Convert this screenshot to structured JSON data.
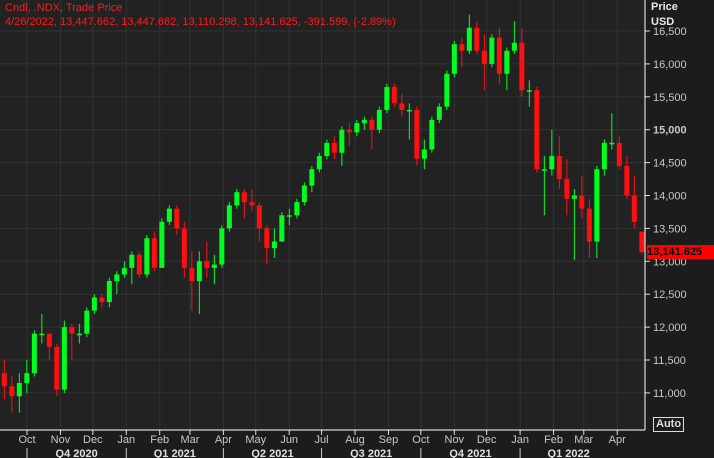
{
  "header": {
    "line1": "Cndl, .NDX, Trade Price",
    "line2": "4/26/2022, 13,447.662, 13,447.662, 13,110.298, 13,141.625, -391.599, (-2.89%)"
  },
  "axis": {
    "title1": "Price",
    "title2": "USD",
    "auto_label": "Auto"
  },
  "last_price_label": "13,141.625",
  "colors": {
    "up": "#00ff1e",
    "down": "#ff1010",
    "background": "#1c1c1c",
    "grid": "#333333"
  },
  "chart_data": {
    "type": "candlestick",
    "title": "Cndl, .NDX, Trade Price",
    "ylabel": "Price USD",
    "ylim": [
      10600,
      17000
    ],
    "y_ticks": [
      11000,
      11500,
      12000,
      12500,
      13000,
      13500,
      14000,
      14500,
      15000,
      15500,
      16000,
      16500
    ],
    "y_tick_labels": [
      "11,000",
      "11,500",
      "12,000",
      "12,500",
      "13,000",
      "13,500",
      "14,000",
      "14,500",
      "15,000",
      "15,500",
      "16,000",
      "16,500"
    ],
    "month_labels": [
      {
        "label": "Oct",
        "date": "2020-10-01"
      },
      {
        "label": "Nov",
        "date": "2020-11-01"
      },
      {
        "label": "Dec",
        "date": "2020-12-01"
      },
      {
        "label": "Jan",
        "date": "2021-01-01"
      },
      {
        "label": "Feb",
        "date": "2021-02-01"
      },
      {
        "label": "Mar",
        "date": "2021-03-01"
      },
      {
        "label": "Apr",
        "date": "2021-04-01"
      },
      {
        "label": "May",
        "date": "2021-05-01"
      },
      {
        "label": "Jun",
        "date": "2021-06-01"
      },
      {
        "label": "Jul",
        "date": "2021-07-01"
      },
      {
        "label": "Aug",
        "date": "2021-08-01"
      },
      {
        "label": "Sep",
        "date": "2021-09-01"
      },
      {
        "label": "Oct",
        "date": "2021-10-01"
      },
      {
        "label": "Nov",
        "date": "2021-11-01"
      },
      {
        "label": "Dec",
        "date": "2021-12-01"
      },
      {
        "label": "Jan",
        "date": "2022-01-01"
      },
      {
        "label": "Feb",
        "date": "2022-02-01"
      },
      {
        "label": "Mar",
        "date": "2022-03-01"
      },
      {
        "label": "Apr",
        "date": "2022-04-01"
      }
    ],
    "quarter_labels": [
      {
        "label": "Q4 2020",
        "start": "2020-10-01",
        "end": "2021-01-01"
      },
      {
        "label": "Q1 2021",
        "start": "2021-01-01",
        "end": "2021-04-01"
      },
      {
        "label": "Q2 2021",
        "start": "2021-04-01",
        "end": "2021-07-01"
      },
      {
        "label": "Q3 2021",
        "start": "2021-07-01",
        "end": "2021-10-01"
      },
      {
        "label": "Q4 2021",
        "start": "2021-10-01",
        "end": "2022-01-01"
      },
      {
        "label": "Q1 2022",
        "start": "2022-01-01",
        "end": "2022-04-01"
      }
    ],
    "candle_period": "weekly (approximation)",
    "first_candle_date": "2020-09-10",
    "candles_ohlc": [
      [
        11300,
        11500,
        10900,
        11100
      ],
      [
        11100,
        11250,
        10700,
        10950
      ],
      [
        10950,
        11300,
        10700,
        11150
      ],
      [
        11150,
        11500,
        11000,
        11300
      ],
      [
        11300,
        11950,
        11250,
        11900
      ],
      [
        11900,
        12200,
        11750,
        11900
      ],
      [
        11900,
        11900,
        11500,
        11700
      ],
      [
        11700,
        11750,
        10950,
        11050
      ],
      [
        11050,
        12100,
        11000,
        12000
      ],
      [
        12000,
        12050,
        11500,
        11900
      ],
      [
        11900,
        12050,
        11750,
        11900
      ],
      [
        11900,
        12300,
        11850,
        12250
      ],
      [
        12250,
        12500,
        12200,
        12450
      ],
      [
        12450,
        12500,
        12300,
        12380
      ],
      [
        12380,
        12750,
        12300,
        12700
      ],
      [
        12700,
        12850,
        12500,
        12800
      ],
      [
        12800,
        13000,
        12750,
        12900
      ],
      [
        12900,
        13150,
        12650,
        13100
      ],
      [
        13100,
        13150,
        12750,
        12800
      ],
      [
        12800,
        13400,
        12750,
        13350
      ],
      [
        13350,
        13450,
        12850,
        12900
      ],
      [
        12900,
        13650,
        12900,
        13600
      ],
      [
        13600,
        13850,
        13550,
        13800
      ],
      [
        13800,
        13850,
        13400,
        13500
      ],
      [
        13500,
        13600,
        12750,
        12900
      ],
      [
        12900,
        13150,
        12250,
        12700
      ],
      [
        12700,
        13150,
        12200,
        13000
      ],
      [
        13000,
        13300,
        12750,
        12900
      ],
      [
        12900,
        13100,
        12650,
        12950
      ],
      [
        12950,
        13550,
        12900,
        13500
      ],
      [
        13500,
        13900,
        13450,
        13850
      ],
      [
        13850,
        14100,
        13800,
        14050
      ],
      [
        14050,
        14100,
        13650,
        13900
      ],
      [
        13900,
        14100,
        13750,
        13850
      ],
      [
        13850,
        13900,
        13300,
        13500
      ],
      [
        13500,
        13550,
        12950,
        13200
      ],
      [
        13200,
        13500,
        13050,
        13300
      ],
      [
        13300,
        13750,
        13300,
        13700
      ],
      [
        13700,
        13800,
        13550,
        13700
      ],
      [
        13700,
        13950,
        13650,
        13900
      ],
      [
        13900,
        14200,
        13850,
        14150
      ],
      [
        14150,
        14450,
        14050,
        14400
      ],
      [
        14400,
        14650,
        14350,
        14600
      ],
      [
        14600,
        14850,
        14550,
        14800
      ],
      [
        14800,
        14900,
        14550,
        14650
      ],
      [
        14650,
        15050,
        14450,
        15000
      ],
      [
        15000,
        15100,
        14750,
        14960
      ],
      [
        14960,
        15150,
        14900,
        15100
      ],
      [
        15100,
        15200,
        15000,
        15150
      ],
      [
        15150,
        15200,
        14700,
        15000
      ],
      [
        15000,
        15350,
        14950,
        15300
      ],
      [
        15300,
        15700,
        15250,
        15650
      ],
      [
        15650,
        15700,
        15350,
        15400
      ],
      [
        15400,
        15550,
        15200,
        15300
      ],
      [
        15300,
        15400,
        14850,
        15300
      ],
      [
        15300,
        15350,
        14450,
        14560
      ],
      [
        14560,
        14850,
        14400,
        14700
      ],
      [
        14700,
        15200,
        14650,
        15150
      ],
      [
        15150,
        15400,
        15100,
        15350
      ],
      [
        15350,
        15900,
        15300,
        15850
      ],
      [
        15850,
        16350,
        15800,
        16300
      ],
      [
        16300,
        16400,
        15950,
        16200
      ],
      [
        16200,
        16750,
        16150,
        16550
      ],
      [
        16550,
        16650,
        16150,
        16200
      ],
      [
        16200,
        16450,
        15600,
        16000
      ],
      [
        16000,
        16450,
        15950,
        16400
      ],
      [
        16400,
        16550,
        15700,
        15850
      ],
      [
        15850,
        16250,
        15600,
        16200
      ],
      [
        16200,
        16650,
        16150,
        16320
      ],
      [
        16320,
        16550,
        15500,
        15600
      ],
      [
        15600,
        15750,
        15350,
        15600
      ],
      [
        15600,
        15650,
        14350,
        14400
      ],
      [
        14400,
        14600,
        13700,
        14400
      ],
      [
        14400,
        15000,
        14300,
        14600
      ],
      [
        14600,
        14900,
        14100,
        14250
      ],
      [
        14250,
        14550,
        13700,
        13950
      ],
      [
        13950,
        14100,
        13020,
        14000
      ],
      [
        14000,
        14300,
        13650,
        13800
      ],
      [
        13800,
        13950,
        13050,
        13300
      ],
      [
        13300,
        14450,
        13050,
        14400
      ],
      [
        14400,
        14850,
        14300,
        14800
      ],
      [
        14800,
        15250,
        14700,
        14800
      ],
      [
        14800,
        14900,
        14400,
        14450
      ],
      [
        14450,
        14600,
        13950,
        14000
      ],
      [
        14000,
        14300,
        13500,
        13600
      ],
      [
        13447.662,
        13447.662,
        13110.298,
        13141.625
      ]
    ],
    "last_price": 13141.625
  }
}
